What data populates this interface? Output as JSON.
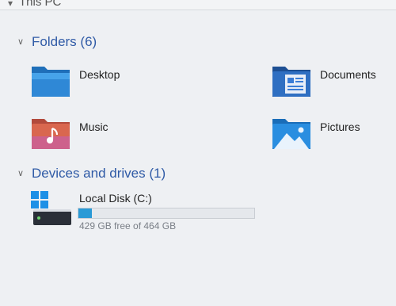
{
  "header": {
    "crumb": "This PC"
  },
  "sections": {
    "folders": {
      "label": "Folders (6)"
    },
    "devices": {
      "label": "Devices and drives (1)"
    }
  },
  "folders": [
    {
      "label": "Desktop",
      "icon": "desktop-folder-icon"
    },
    {
      "label": "Documents",
      "icon": "documents-folder-icon"
    },
    {
      "label": "Music",
      "icon": "music-folder-icon"
    },
    {
      "label": "Pictures",
      "icon": "pictures-folder-icon"
    }
  ],
  "drive": {
    "label": "Local Disk (C:)",
    "free_text": "429 GB free of 464 GB",
    "used_fraction": 0.075,
    "bar_color": "#2a9ad6"
  },
  "colors": {
    "section_heading": "#2f5aa6",
    "desktop_folder": "#2f88d6",
    "documents_folder": "#2f6fc2",
    "music_folder": "#e07a5f",
    "pictures_folder": "#2a8ee0"
  }
}
